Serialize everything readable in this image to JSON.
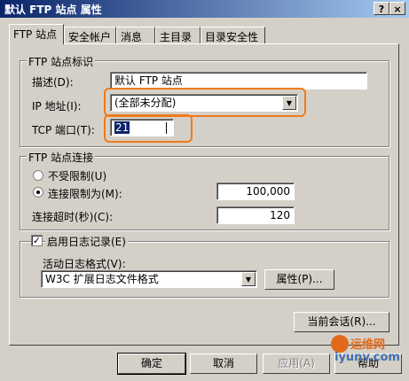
{
  "window": {
    "title": "默认 FTP 站点 属性",
    "help_btn": "?",
    "close_btn": "×"
  },
  "tabs": [
    {
      "label": "FTP 站点",
      "active": true
    },
    {
      "label": "安全帐户"
    },
    {
      "label": "消息"
    },
    {
      "label": "主目录"
    },
    {
      "label": "目录安全性"
    }
  ],
  "site_id_group": {
    "title": "FTP 站点标识",
    "desc_label": "描述(D):",
    "desc_value": "默认 FTP 站点",
    "ip_label": "IP 地址(I):",
    "ip_value": "(全部未分配)",
    "tcp_label": "TCP 端口(T):",
    "tcp_value": "21"
  },
  "conn_group": {
    "title": "FTP 站点连接",
    "unlimited_label": "不受限制(U)",
    "limited_label": "连接限制为(M):",
    "limit_value": "100,000",
    "timeout_label": "连接超时(秒)(C):",
    "timeout_value": "120"
  },
  "log_group": {
    "enable_label": "启用日志记录(E)",
    "format_label": "活动日志格式(V):",
    "format_value": "W3C 扩展日志文件格式",
    "props_btn": "属性(P)..."
  },
  "sessions_btn": "当前会话(R)...",
  "footer": {
    "ok": "确定",
    "cancel": "取消",
    "apply": "应用(A)",
    "help": "帮助"
  },
  "watermark": {
    "text1": "运维网",
    "text2": "iyunv.com"
  },
  "colors": {
    "highlight": "#f07a1a",
    "titlebar": "#0a246a"
  }
}
